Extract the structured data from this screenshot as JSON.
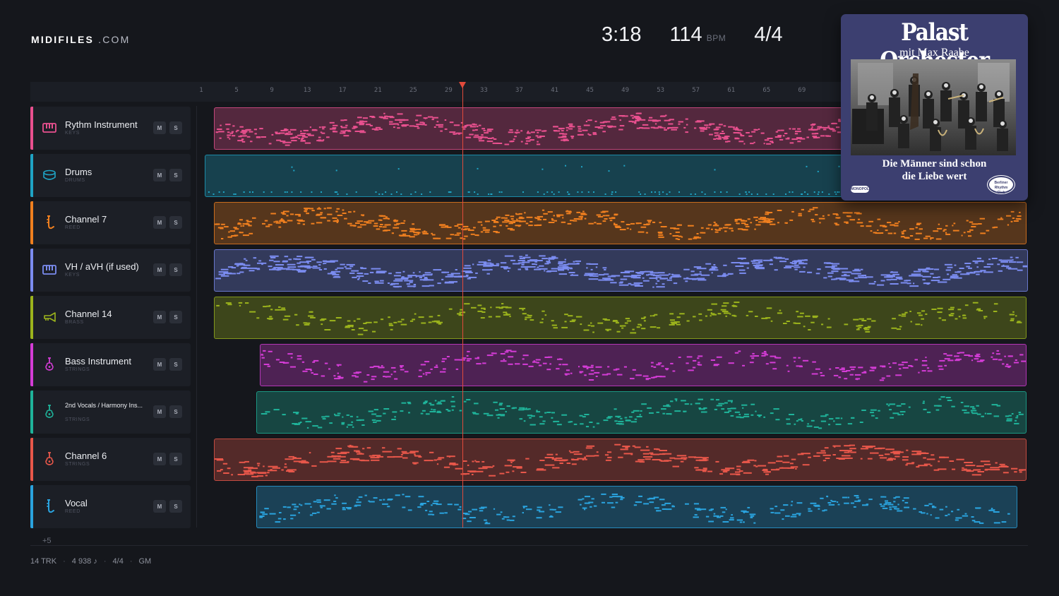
{
  "header": {
    "logo_main": "MIDIFILES",
    "logo_suffix": ".COM",
    "time": "3:18",
    "bpm": "114",
    "bpm_unit": "BPM",
    "time_signature": "4/4"
  },
  "ruler": {
    "ticks": [
      "1",
      "5",
      "9",
      "13",
      "17",
      "21",
      "25",
      "29",
      "33",
      "37",
      "41",
      "45",
      "49",
      "53",
      "57",
      "61",
      "65",
      "69"
    ]
  },
  "playhead_bar": 30,
  "tracks": [
    {
      "name": "Rythm Instrument",
      "category": "KEYS",
      "color": "#e9508f",
      "icon": "piano-icon",
      "mute_label": "M",
      "solo_label": "S"
    },
    {
      "name": "Drums",
      "category": "DRUMS",
      "color": "#1fa3c4",
      "icon": "drum-icon",
      "mute_label": "M",
      "solo_label": "S"
    },
    {
      "name": "Channel 7",
      "category": "REED",
      "color": "#ef7f1f",
      "icon": "reed-icon",
      "mute_label": "M",
      "solo_label": "S"
    },
    {
      "name": "VH / aVH (if used)",
      "category": "KEYS",
      "color": "#7b8cf0",
      "icon": "piano-icon",
      "mute_label": "M",
      "solo_label": "S"
    },
    {
      "name": "Channel 14",
      "category": "BRASS",
      "color": "#9bb31c",
      "icon": "trumpet-icon",
      "mute_label": "M",
      "solo_label": "S"
    },
    {
      "name": "Bass Instrument",
      "category": "STRINGS",
      "color": "#d43cd6",
      "icon": "guitar-icon",
      "mute_label": "M",
      "solo_label": "S"
    },
    {
      "name": "2nd Vocals / Harmony Ins...",
      "category": "STRINGS",
      "color": "#1fb39a",
      "icon": "guitar-icon",
      "mute_label": "M",
      "solo_label": "S"
    },
    {
      "name": "Channel 6",
      "category": "STRINGS",
      "color": "#e8574a",
      "icon": "guitar-icon",
      "mute_label": "M",
      "solo_label": "S"
    },
    {
      "name": "Vocal",
      "category": "REED",
      "color": "#2aa3de",
      "icon": "reed-icon",
      "mute_label": "M",
      "solo_label": "S"
    }
  ],
  "more_tracks": "+5",
  "footer": {
    "tracks": "14 TRK",
    "notes": "4 938 ♪",
    "signature": "4/4",
    "standard": "GM"
  },
  "album": {
    "title": "Palast Orchester",
    "subtitle": "mit Max Raabe",
    "song_line1": "Die Männer sind schon",
    "song_line2": "die Liebe wert",
    "label_left": "MONOPOL",
    "label_right_1": "Berliner",
    "label_right_2": "Rhythm",
    "label_right_3": "Club"
  }
}
